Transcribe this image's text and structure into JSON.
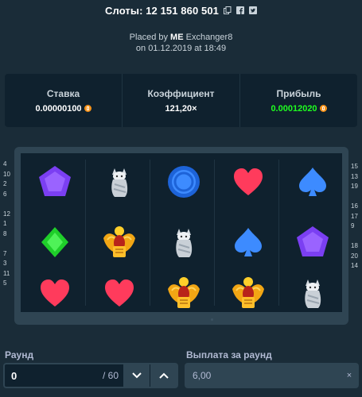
{
  "header": {
    "title": "Слоты: 12 151 860 501",
    "icons": [
      "copy-icon",
      "facebook-icon",
      "twitter-icon"
    ]
  },
  "placed": {
    "prefix": "Placed by",
    "user": "ME",
    "username": "Exchanger8",
    "date_line": "on 01.12.2019 at 18:49"
  },
  "stats": {
    "bet_label": "Ставка",
    "bet_value": "0.00000100",
    "multiplier_label": "Коэффициент",
    "multiplier_value": "121,20×",
    "profit_label": "Прибыль",
    "profit_value": "0.00012020",
    "currency_icon": "bitcoin-icon",
    "profit_color": "#1fff20"
  },
  "slots": {
    "reels": [
      [
        "gem",
        "diamond",
        "heart"
      ],
      [
        "cat",
        "scarab",
        "heart"
      ],
      [
        "coin",
        "cat",
        "scarab"
      ],
      [
        "heart",
        "spade",
        "scarab"
      ],
      [
        "spade",
        "gem",
        "cat"
      ]
    ],
    "left_lines": [
      "4",
      "10",
      "2",
      "6",
      "",
      "12",
      "1",
      "8",
      "",
      "7",
      "3",
      "11",
      "5"
    ],
    "right_lines": [
      "15",
      "13",
      "19",
      "",
      "16",
      "17",
      "9",
      "",
      "18",
      "20",
      "14"
    ]
  },
  "round": {
    "label": "Раунд",
    "value": "0",
    "max": "/ 60"
  },
  "payout": {
    "label": "Выплата за раунд",
    "value": "6,00",
    "clear_symbol": "×"
  }
}
